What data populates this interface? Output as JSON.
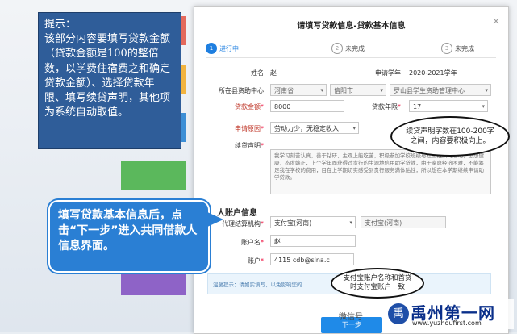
{
  "hint": {
    "title": "提示：",
    "text": "该部分内容要填写贷款金额（贷款金额是100的整倍数，以学费住宿费之和确定贷款金额）、选择贷款年限、填写续贷声明，其他项为系统自动取值。"
  },
  "modal": {
    "title": "请填写贷款信息-贷款基本信息",
    "close": "×",
    "steps": [
      {
        "num": "1",
        "label": "进行中"
      },
      {
        "num": "2",
        "label": "未完成"
      },
      {
        "num": "3",
        "label": "未完成"
      }
    ]
  },
  "form": {
    "name_label": "姓名",
    "name_value": "赵",
    "year_label": "申请学年",
    "year_value": "2020-2021学年",
    "center_label": "所在县资助中心",
    "province": "河南省",
    "city": "信阳市",
    "center": "罗山县学生资助管理中心",
    "amount_label": "贷款金额",
    "amount_value": "8000",
    "term_label": "贷款年限",
    "term_value": "17",
    "reason_label": "申请原因",
    "reason_value": "劳动力少，无稳定收入",
    "statement_label": "续贷声明",
    "statement_text": "我学习刻苦认真，善于钻研，主观上能吃苦，积极参加学校班级与社团组织的活动，思想健康，态度端正，上个学年面获得过贵行的生源地信用助学贷款，由于家庭经济困难，不能筹足我在学校的费用，目在上学期切实感受到贵行服务满体贴性，所以想在本学期继续申请助学贷款。"
  },
  "account": {
    "section_title": "人账户信息",
    "agency_label": "代理结算机构",
    "agency_value": "支付宝(河南)",
    "agency_value2": "支付宝(河南)",
    "account_name_label": "账户名",
    "account_name_value": "赵",
    "account_label": "账户",
    "account_value": "4115                cdb@slna.c"
  },
  "notice_text": "温馨提示：请如实填写，以免影响您的",
  "next_button": "下一步",
  "callouts": {
    "statement_note": "续贷声明字数在100-200字之间，内容要积极向上。",
    "alipay_note": "支付宝账户名称和首贷时支付宝账户一致"
  },
  "bubble_text": "填写贷款基本信息后，点击“下一步”进入共同借款人信息界面。",
  "watermark": {
    "logo_glyph": "禹",
    "title": "禹州第一网",
    "url": "www.yuzhoufirst.com",
    "wechat": "微信号"
  }
}
